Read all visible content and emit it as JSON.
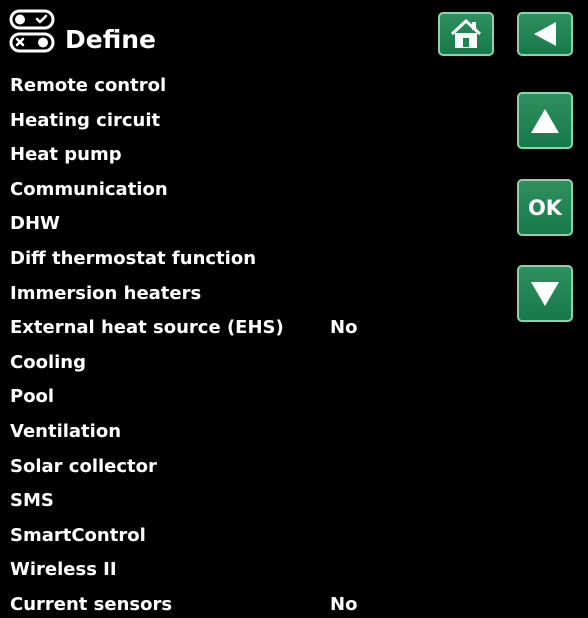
{
  "header": {
    "title": "Define",
    "title_icon": "toggle-switches-icon",
    "home_icon": "home-icon",
    "back_icon": "back-arrow-icon"
  },
  "nav": {
    "up_icon": "up-arrow-icon",
    "ok_label": "OK",
    "down_icon": "down-arrow-icon"
  },
  "colors": {
    "background": "#000000",
    "text": "#ffffff",
    "button": "#1f8553",
    "button_border": "#8bd3ac"
  },
  "menu": {
    "items": [
      {
        "label": "Remote control",
        "value": ""
      },
      {
        "label": "Heating circuit",
        "value": ""
      },
      {
        "label": "Heat pump",
        "value": ""
      },
      {
        "label": "Communication",
        "value": ""
      },
      {
        "label": "DHW",
        "value": ""
      },
      {
        "label": "Diff thermostat function",
        "value": ""
      },
      {
        "label": "Immersion heaters",
        "value": ""
      },
      {
        "label": "External heat source (EHS)",
        "value": "No"
      },
      {
        "label": "Cooling",
        "value": ""
      },
      {
        "label": "Pool",
        "value": ""
      },
      {
        "label": "Ventilation",
        "value": ""
      },
      {
        "label": "Solar collector",
        "value": ""
      },
      {
        "label": "SMS",
        "value": ""
      },
      {
        "label": "SmartControl",
        "value": ""
      },
      {
        "label": "Wireless II",
        "value": ""
      },
      {
        "label": "Current sensors",
        "value": "No"
      }
    ]
  }
}
